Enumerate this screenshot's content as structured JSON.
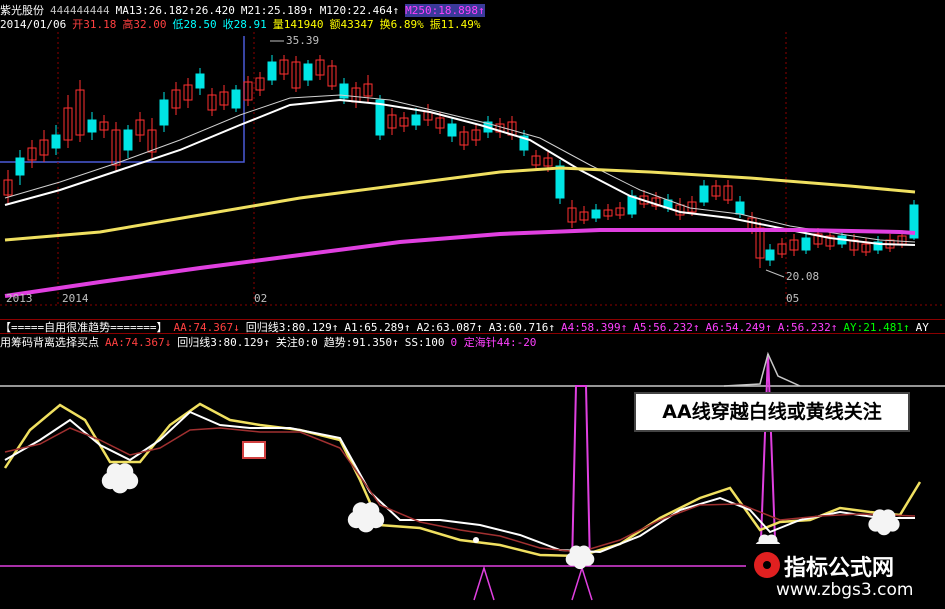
{
  "header": {
    "row1": [
      {
        "text": "紫光股份",
        "color": "#ffffff"
      },
      {
        "text": "444444444",
        "color": "#c0c0c0"
      },
      {
        "text": "MA13:26.182↑26.420",
        "color": "#ffffff"
      },
      {
        "text": "M21:25.189↑",
        "color": "#ffffff"
      },
      {
        "text": "M120:22.464↑",
        "color": "#ffffff"
      },
      {
        "text": "M250:18.898↑",
        "color": "#ff40ff",
        "bg": "#3a3a9a"
      }
    ],
    "row2": [
      {
        "text": "2014/01/06",
        "color": "#ffffff"
      },
      {
        "text": "开31.18",
        "color": "#ff4040"
      },
      {
        "text": "高32.00",
        "color": "#ff4040"
      },
      {
        "text": "低28.50",
        "color": "#00ffff"
      },
      {
        "text": "收28.91",
        "color": "#00ffff"
      },
      {
        "text": "量141940",
        "color": "#ffff00"
      },
      {
        "text": "额43347",
        "color": "#ffff00"
      },
      {
        "text": "换6.89%",
        "color": "#ffff00"
      },
      {
        "text": "振11.49%",
        "color": "#ffff00"
      }
    ]
  },
  "price_labels": {
    "high": "35.39",
    "low": "20.08"
  },
  "date_axis": [
    "2013",
    "2014",
    "02",
    "05"
  ],
  "indicator_row1": [
    {
      "text": "【=====自用很准趋势=======】",
      "color": "#ffffff"
    },
    {
      "text": "AA:74.367↓",
      "color": "#ff4040"
    },
    {
      "text": "回归线3:80.129↑",
      "color": "#ffffff"
    },
    {
      "text": "A1:65.289↑",
      "color": "#ffffff"
    },
    {
      "text": "A2:63.087↑",
      "color": "#ffffff"
    },
    {
      "text": "A3:60.716↑",
      "color": "#ffffff"
    },
    {
      "text": "A4:58.399↑",
      "color": "#ff40ff"
    },
    {
      "text": "A5:56.232↑",
      "color": "#ff40ff"
    },
    {
      "text": "A6:54.249↑",
      "color": "#ff40ff"
    },
    {
      "text": "A:56.232↑",
      "color": "#ff40ff"
    },
    {
      "text": "AY:21.481↑",
      "color": "#00ff00"
    },
    {
      "text": "AY",
      "color": "#ffffff"
    }
  ],
  "indicator_row2": [
    {
      "text": "用筹码背离选择买点",
      "color": "#ffffff"
    },
    {
      "text": "AA:74.367↓",
      "color": "#ff4040"
    },
    {
      "text": "回归线3:80.129↑",
      "color": "#ffffff"
    },
    {
      "text": "关注0:0",
      "color": "#ffffff"
    },
    {
      "text": "趋势:91.350↑",
      "color": "#ffffff"
    },
    {
      "text": "SS:100",
      "color": "#ffffff"
    },
    {
      "text": "0 定海针44:-20",
      "color": "#ff40ff"
    }
  ],
  "callout": {
    "text": "AA线穿越白线或黄线关注"
  },
  "watermark": {
    "title": "指标公式网",
    "url": "www.zbgs3.com"
  },
  "colors": {
    "up": "#ff3030",
    "down": "#00e5e5",
    "ma_white": "#ffffff",
    "ma_yellow": "#f0e060",
    "ma_magenta": "#e040e0"
  }
}
